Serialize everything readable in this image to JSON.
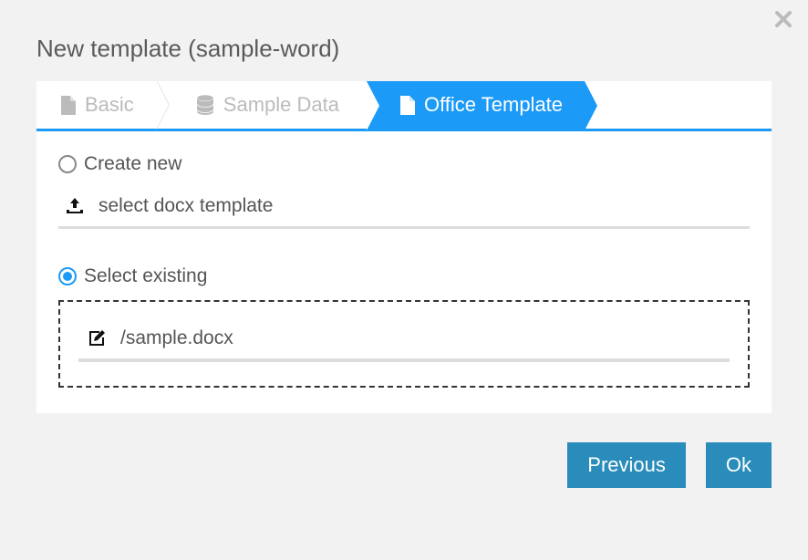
{
  "dialog": {
    "title": "New template (sample-word)"
  },
  "steps": {
    "basic": "Basic",
    "sampleData": "Sample Data",
    "officeTemplate": "Office Template"
  },
  "options": {
    "createNew": {
      "label": "Create new",
      "placeholder": "select docx template"
    },
    "selectExisting": {
      "label": "Select existing",
      "value": "/sample.docx"
    }
  },
  "buttons": {
    "previous": "Previous",
    "ok": "Ok"
  }
}
